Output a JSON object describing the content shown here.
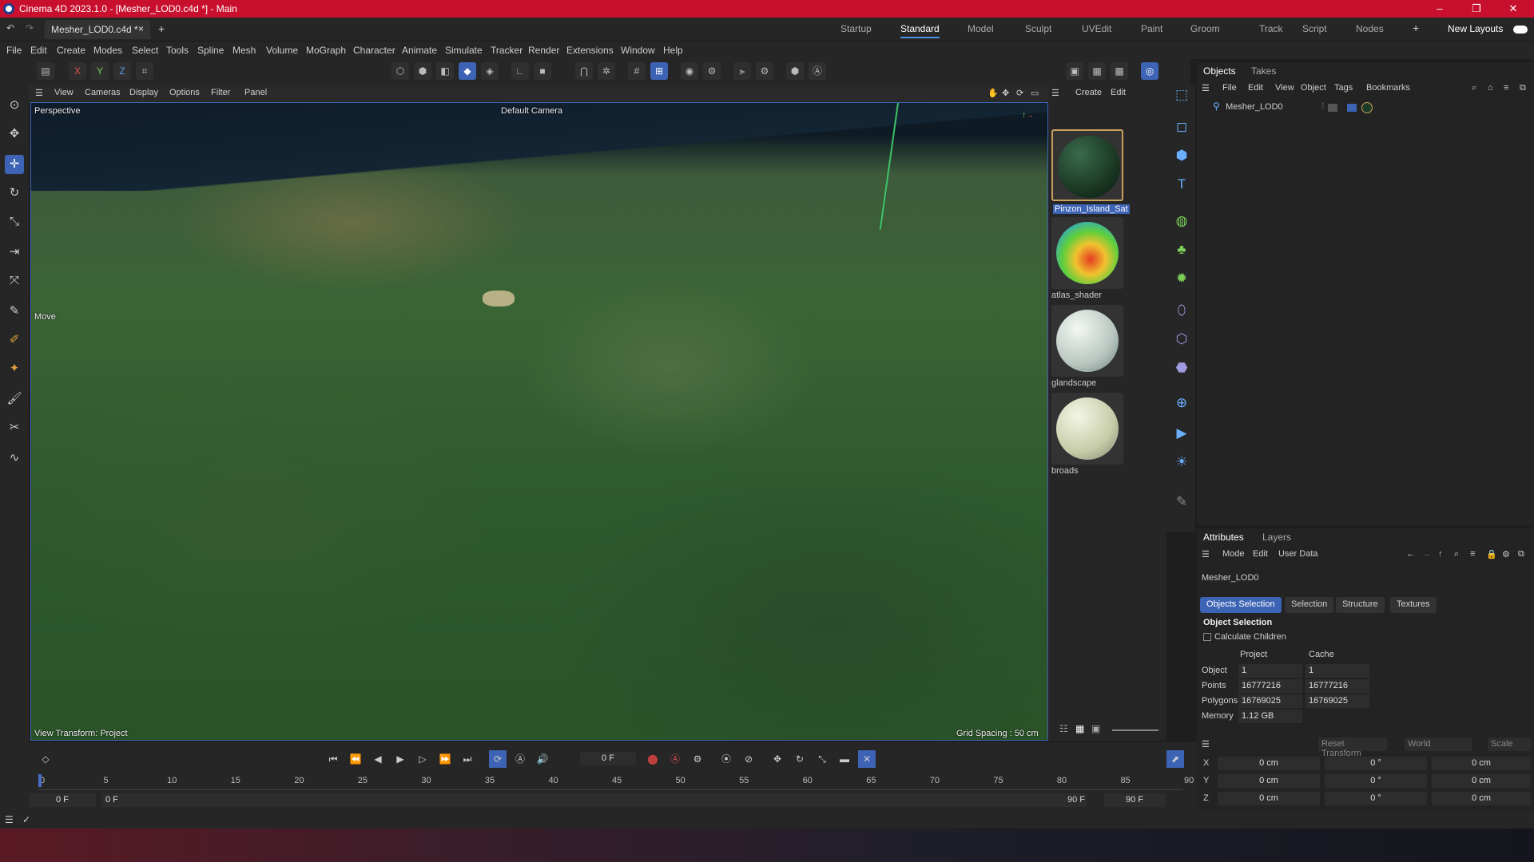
{
  "window": {
    "title": "Cinema 4D 2023.1.0 - [Mesher_LOD0.c4d *] - Main",
    "minimize": "–",
    "restore": "❐",
    "close": "✕"
  },
  "doc_tab": {
    "label": "Mesher_LOD0.c4d *",
    "close": "×",
    "add": "+"
  },
  "layouts": [
    "Startup",
    "Standard",
    "Model",
    "Sculpt",
    "UVEdit",
    "Paint",
    "Groom",
    "Track",
    "Script",
    "Nodes"
  ],
  "layouts_active": "Standard",
  "layouts_add": "+",
  "new_layouts": "New Layouts",
  "menu": [
    "File",
    "Edit",
    "Create",
    "Modes",
    "Select",
    "Tools",
    "Spline",
    "Mesh",
    "Volume",
    "MoGraph",
    "Character",
    "Animate",
    "Simulate",
    "Tracker",
    "Render",
    "Extensions",
    "Window",
    "Help"
  ],
  "axis_toggles": [
    "X",
    "Y",
    "Z"
  ],
  "viewport_menu": [
    "View",
    "Cameras",
    "Display",
    "Options",
    "Filter",
    "Panel"
  ],
  "viewport": {
    "projection": "Perspective",
    "camera": "Default Camera",
    "tool": "Move",
    "view_transform": "View Transform: Project",
    "grid": "Grid Spacing : 50 cm"
  },
  "material_menu": [
    "Create",
    "Edit"
  ],
  "materials": [
    {
      "name": "Pinzon_Island_Sat"
    },
    {
      "name": "atlas_shader"
    },
    {
      "name": "glandscape"
    },
    {
      "name": "broads"
    }
  ],
  "objects_panel": {
    "tabs": [
      "Objects",
      "Takes"
    ],
    "menu": [
      "File",
      "Edit",
      "View",
      "Object",
      "Tags",
      "Bookmarks"
    ],
    "items": [
      {
        "name": "Mesher_LOD0"
      }
    ]
  },
  "attributes": {
    "tabs": [
      "Attributes",
      "Layers"
    ],
    "menu": [
      "Mode",
      "Edit",
      "User Data"
    ],
    "object_name": "Mesher_LOD0",
    "subtabs": [
      "Objects Selection",
      "Selection",
      "Structure",
      "Textures"
    ],
    "section": "Object Selection",
    "calc_children": "Calculate Children",
    "cols": [
      "Project",
      "Cache"
    ],
    "rows": [
      {
        "label": "Object",
        "project": "1",
        "cache": "1"
      },
      {
        "label": "Points",
        "project": "16777216",
        "cache": "16777216"
      },
      {
        "label": "Polygons",
        "project": "16769025",
        "cache": "16769025"
      },
      {
        "label": "Memory",
        "project": "1.12 GB",
        "cache": ""
      }
    ]
  },
  "coords": {
    "reset": "Reset Transform",
    "space": "World",
    "mode": "Scale",
    "rows": [
      {
        "axis": "X",
        "a": "0 cm",
        "b": "0 °",
        "c": "0 cm"
      },
      {
        "axis": "Y",
        "a": "0 cm",
        "b": "0 °",
        "c": "0 cm"
      },
      {
        "axis": "Z",
        "a": "0 cm",
        "b": "0 °",
        "c": "0 cm"
      }
    ]
  },
  "timeline": {
    "current": "0 F",
    "start": "0 F",
    "start2": "0 F",
    "end": "90 F",
    "end2": "90 F",
    "ticks": [
      "0",
      "5",
      "10",
      "15",
      "20",
      "25",
      "30",
      "35",
      "40",
      "45",
      "50",
      "55",
      "60",
      "65",
      "70",
      "75",
      "80",
      "85",
      "90"
    ]
  }
}
